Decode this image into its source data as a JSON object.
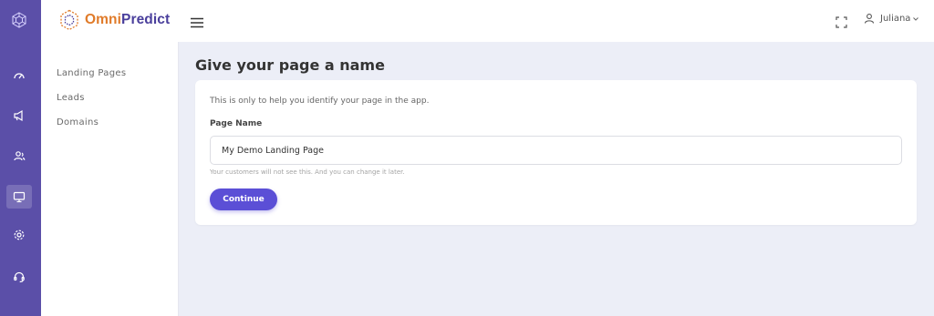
{
  "brand": {
    "name_part1": "Omni",
    "name_part2": "Predict",
    "accent": "#5b4fa8",
    "orange": "#e07b2a"
  },
  "rail": {
    "icons": [
      "logo-hex-icon",
      "dashboard-gauge-icon",
      "megaphone-icon",
      "users-icon",
      "monitor-icon",
      "settings-gear-icon",
      "headset-support-icon"
    ],
    "active": "monitor-icon"
  },
  "header": {
    "user_name": "Juliana"
  },
  "subnav": {
    "items": [
      {
        "label": "Landing Pages"
      },
      {
        "label": "Leads"
      },
      {
        "label": "Domains"
      }
    ]
  },
  "main": {
    "title": "Give your page a name",
    "help_text": "This is only to help you identify your page in the app.",
    "field_label": "Page Name",
    "field_value": "My Demo Landing Page",
    "hint": "Your customers will not see this. And you can change it later.",
    "button_label": "Continue",
    "button_color": "#5b4fd6"
  }
}
